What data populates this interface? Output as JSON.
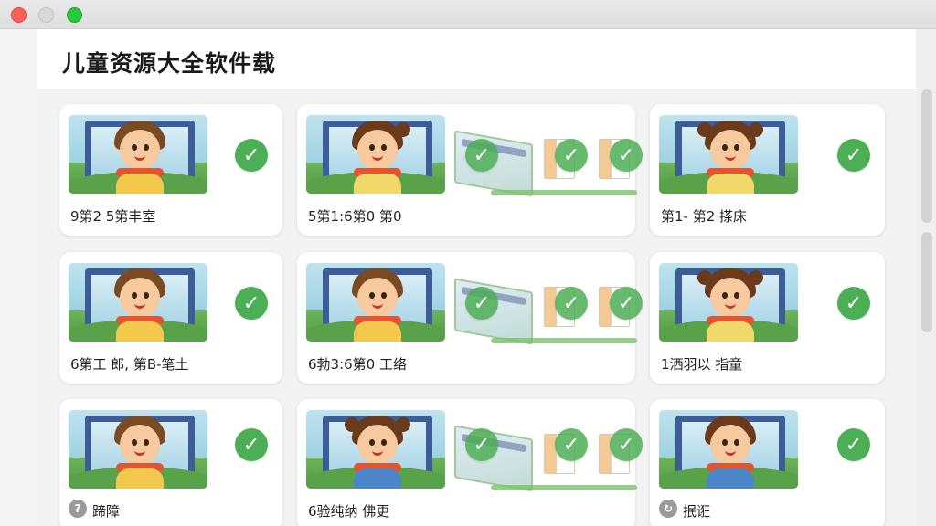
{
  "app": {
    "title": "儿童资源大全软件载"
  },
  "colors": {
    "check_green": "#4cae55",
    "frame_blue": "#3c5d98"
  },
  "icons": {
    "check": "✓",
    "help": "?",
    "refresh": "↻"
  },
  "cards": [
    {
      "label": "9第2 5第丰室"
    },
    {
      "label": "5第1:6第0 第0"
    },
    {
      "label": "第1- 第2 搽床"
    },
    {
      "label": "6第工 郎, 第B-笔土"
    },
    {
      "label": "6勃3:6第0 工络"
    },
    {
      "label": "1洒羽以 指童"
    },
    {
      "label": "蹄障"
    },
    {
      "label": "6验纯纳 佛更"
    },
    {
      "label": "抿诳"
    }
  ]
}
